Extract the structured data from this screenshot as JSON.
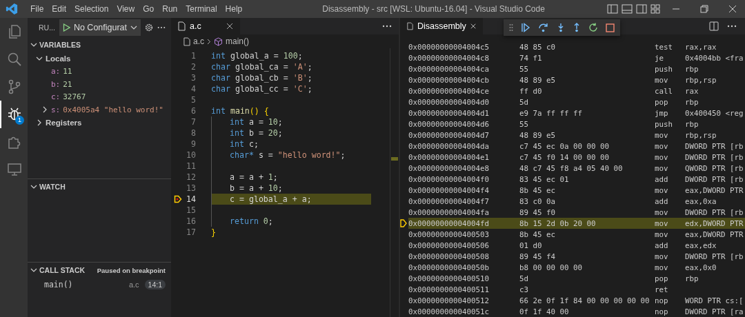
{
  "window": {
    "title": "Disassembly - src [WSL: Ubuntu-16.04] - Visual Studio Code"
  },
  "menu": [
    "File",
    "Edit",
    "Selection",
    "View",
    "Go",
    "Run",
    "Terminal",
    "Help"
  ],
  "activity_bar": [
    {
      "kind": "files",
      "selected": false
    },
    {
      "kind": "search",
      "selected": false
    },
    {
      "kind": "source-control",
      "selected": false
    },
    {
      "kind": "debug",
      "selected": true,
      "badge": "1"
    },
    {
      "kind": "extensions",
      "selected": false
    },
    {
      "kind": "remote",
      "selected": false
    }
  ],
  "run_panel": {
    "title": "RU...",
    "configuration": "No Configurat",
    "variables": {
      "title": "VARIABLES",
      "expanded": true,
      "scopes": [
        {
          "name": "Locals",
          "expanded": true,
          "children": [
            {
              "name": "a:",
              "value": "11",
              "kind": "number"
            },
            {
              "name": "b:",
              "value": "21",
              "kind": "number"
            },
            {
              "name": "c:",
              "value": "32767",
              "kind": "number"
            },
            {
              "name": "s:",
              "value": "0x4005a4 \"hello word!\"",
              "kind": "string",
              "expanded": false
            }
          ]
        },
        {
          "name": "Registers",
          "expanded": false
        }
      ]
    },
    "watch": {
      "title": "WATCH",
      "expanded": true
    },
    "call_stack": {
      "title": "CALL STACK",
      "expanded": true,
      "status": "Paused on breakpoint",
      "frames": [
        {
          "name": "main()",
          "file": "a.c",
          "position": "14:1"
        }
      ]
    }
  },
  "editor": {
    "tabs": [
      {
        "label": "a.c",
        "selected": true
      }
    ],
    "breadcrumb": [
      "a.c",
      "main()"
    ],
    "lines": [
      {
        "number": "1",
        "indented": false,
        "current": false,
        "tokens": [
          {
            "kind": "keyword",
            "text": "int"
          },
          {
            "kind": "plain",
            "text": " global_a = "
          },
          {
            "kind": "number",
            "text": "100"
          },
          {
            "kind": "plain",
            "text": ";"
          }
        ]
      },
      {
        "number": "2",
        "indented": false,
        "current": false,
        "tokens": [
          {
            "kind": "keyword",
            "text": "char"
          },
          {
            "kind": "plain",
            "text": " global_ca = "
          },
          {
            "kind": "string",
            "text": "'A'"
          },
          {
            "kind": "plain",
            "text": ";"
          }
        ]
      },
      {
        "number": "3",
        "indented": false,
        "current": false,
        "tokens": [
          {
            "kind": "keyword",
            "text": "char"
          },
          {
            "kind": "plain",
            "text": " global_cb = "
          },
          {
            "kind": "string",
            "text": "'B'"
          },
          {
            "kind": "plain",
            "text": ";"
          }
        ]
      },
      {
        "number": "4",
        "indented": false,
        "current": false,
        "tokens": [
          {
            "kind": "keyword",
            "text": "char"
          },
          {
            "kind": "plain",
            "text": " global_cc = "
          },
          {
            "kind": "string",
            "text": "'C'"
          },
          {
            "kind": "plain",
            "text": ";"
          }
        ]
      },
      {
        "number": "5",
        "current": false
      },
      {
        "number": "6",
        "indented": false,
        "current": false,
        "tokens": [
          {
            "kind": "keyword",
            "text": "int"
          },
          {
            "kind": "function",
            "text": " main"
          },
          {
            "kind": "bracket",
            "text": "()"
          },
          {
            "kind": "bracket",
            "text": " {"
          }
        ]
      },
      {
        "number": "7",
        "indented": true,
        "current": false,
        "tokens": [
          {
            "kind": "keyword",
            "text": "int"
          },
          {
            "kind": "plain",
            "text": " a = "
          },
          {
            "kind": "number",
            "text": "10"
          },
          {
            "kind": "plain",
            "text": ";"
          }
        ]
      },
      {
        "number": "8",
        "indented": true,
        "current": false,
        "tokens": [
          {
            "kind": "keyword",
            "text": "int"
          },
          {
            "kind": "plain",
            "text": " b = "
          },
          {
            "kind": "number",
            "text": "20"
          },
          {
            "kind": "plain",
            "text": ";"
          }
        ]
      },
      {
        "number": "9",
        "indented": true,
        "current": false,
        "tokens": [
          {
            "kind": "keyword",
            "text": "int"
          },
          {
            "kind": "plain",
            "text": " c;"
          }
        ]
      },
      {
        "number": "10",
        "indented": true,
        "current": false,
        "tokens": [
          {
            "kind": "keyword",
            "text": "char*"
          },
          {
            "kind": "plain",
            "text": " s = "
          },
          {
            "kind": "string",
            "text": "\"hello word!\""
          },
          {
            "kind": "plain",
            "text": ";"
          }
        ]
      },
      {
        "number": "11",
        "indented": true,
        "current": false
      },
      {
        "number": "12",
        "indented": true,
        "current": false,
        "tokens": [
          {
            "kind": "plain",
            "text": "a = a + "
          },
          {
            "kind": "number",
            "text": "1"
          },
          {
            "kind": "plain",
            "text": ";"
          }
        ]
      },
      {
        "number": "13",
        "indented": true,
        "current": false,
        "tokens": [
          {
            "kind": "plain",
            "text": "b = a + "
          },
          {
            "kind": "number",
            "text": "10"
          },
          {
            "kind": "plain",
            "text": ";"
          }
        ]
      },
      {
        "number": "14",
        "indented": true,
        "current": true,
        "tokens": [
          {
            "kind": "plain",
            "text": "c = global_a + a;"
          }
        ]
      },
      {
        "number": "15",
        "indented": true,
        "current": false
      },
      {
        "number": "16",
        "indented": true,
        "current": false,
        "tokens": [
          {
            "kind": "keyword",
            "text": "return"
          },
          {
            "kind": "number",
            "text": " 0"
          },
          {
            "kind": "plain",
            "text": ";"
          }
        ]
      },
      {
        "number": "17",
        "indented": false,
        "current": false,
        "tokens": [
          {
            "kind": "bracket",
            "text": "}"
          }
        ]
      }
    ]
  },
  "debug_toolbar": [
    {
      "kind": "continue"
    },
    {
      "kind": "step-over"
    },
    {
      "kind": "step-into"
    },
    {
      "kind": "step-out"
    },
    {
      "kind": "restart"
    },
    {
      "kind": "stop"
    }
  ],
  "disassembly": {
    "tabs": [
      {
        "label": "Disassembly",
        "selected": true
      }
    ],
    "rows": [
      {
        "address": "0x00000000004004c5",
        "bytes": "48 85 c0",
        "mnemonic": "test",
        "operands": "rax,rax",
        "current": false
      },
      {
        "address": "0x00000000004004c8",
        "bytes": "74 f1",
        "mnemonic": "je",
        "operands": "0x4004bb <fra",
        "current": false
      },
      {
        "address": "0x00000000004004ca",
        "bytes": "55",
        "mnemonic": "push",
        "operands": "rbp",
        "current": false
      },
      {
        "address": "0x00000000004004cb",
        "bytes": "48 89 e5",
        "mnemonic": "mov",
        "operands": "rbp,rsp",
        "current": false
      },
      {
        "address": "0x00000000004004ce",
        "bytes": "ff d0",
        "mnemonic": "call",
        "operands": "rax",
        "current": false
      },
      {
        "address": "0x00000000004004d0",
        "bytes": "5d",
        "mnemonic": "pop",
        "operands": "rbp",
        "current": false
      },
      {
        "address": "0x00000000004004d1",
        "bytes": "e9 7a ff ff ff",
        "mnemonic": "jmp",
        "operands": "0x400450 <reg",
        "current": false
      },
      {
        "address": "0x00000000004004d6",
        "bytes": "55",
        "mnemonic": "push",
        "operands": "rbp",
        "current": false
      },
      {
        "address": "0x00000000004004d7",
        "bytes": "48 89 e5",
        "mnemonic": "mov",
        "operands": "rbp,rsp",
        "current": false
      },
      {
        "address": "0x00000000004004da",
        "bytes": "c7 45 ec 0a 00 00 00",
        "mnemonic": "mov",
        "operands": "DWORD PTR [rb",
        "current": false
      },
      {
        "address": "0x00000000004004e1",
        "bytes": "c7 45 f0 14 00 00 00",
        "mnemonic": "mov",
        "operands": "DWORD PTR [rb",
        "current": false
      },
      {
        "address": "0x00000000004004e8",
        "bytes": "48 c7 45 f8 a4 05 40 00",
        "mnemonic": "mov",
        "operands": "QWORD PTR [rb",
        "current": false
      },
      {
        "address": "0x00000000004004f0",
        "bytes": "83 45 ec 01",
        "mnemonic": "add",
        "operands": "DWORD PTR [rb",
        "current": false
      },
      {
        "address": "0x00000000004004f4",
        "bytes": "8b 45 ec",
        "mnemonic": "mov",
        "operands": "eax,DWORD PTR",
        "current": false
      },
      {
        "address": "0x00000000004004f7",
        "bytes": "83 c0 0a",
        "mnemonic": "add",
        "operands": "eax,0xa",
        "current": false
      },
      {
        "address": "0x00000000004004fa",
        "bytes": "89 45 f0",
        "mnemonic": "mov",
        "operands": "DWORD PTR [rb",
        "current": false
      },
      {
        "address": "0x00000000004004fd",
        "bytes": "8b 15 2d 0b 20 00",
        "mnemonic": "mov",
        "operands": "edx,DWORD PTR",
        "current": true
      },
      {
        "address": "0x0000000000400503",
        "bytes": "8b 45 ec",
        "mnemonic": "mov",
        "operands": "eax,DWORD PTR",
        "current": false
      },
      {
        "address": "0x0000000000400506",
        "bytes": "01 d0",
        "mnemonic": "add",
        "operands": "eax,edx",
        "current": false
      },
      {
        "address": "0x0000000000400508",
        "bytes": "89 45 f4",
        "mnemonic": "mov",
        "operands": "DWORD PTR [rb",
        "current": false
      },
      {
        "address": "0x000000000040050b",
        "bytes": "b8 00 00 00 00",
        "mnemonic": "mov",
        "operands": "eax,0x0",
        "current": false
      },
      {
        "address": "0x0000000000400510",
        "bytes": "5d",
        "mnemonic": "pop",
        "operands": "rbp",
        "current": false
      },
      {
        "address": "0x0000000000400511",
        "bytes": "c3",
        "mnemonic": "ret",
        "current": false
      },
      {
        "address": "0x0000000000400512",
        "bytes": "66 2e 0f 1f 84 00 00 00 00 00",
        "mnemonic": "nop",
        "operands": "WORD PTR cs:[",
        "current": false
      },
      {
        "address": "0x000000000040051c",
        "bytes": "0f 1f 40 00",
        "mnemonic": "nop",
        "operands": "DWORD PTR [ra",
        "current": false
      }
    ]
  }
}
